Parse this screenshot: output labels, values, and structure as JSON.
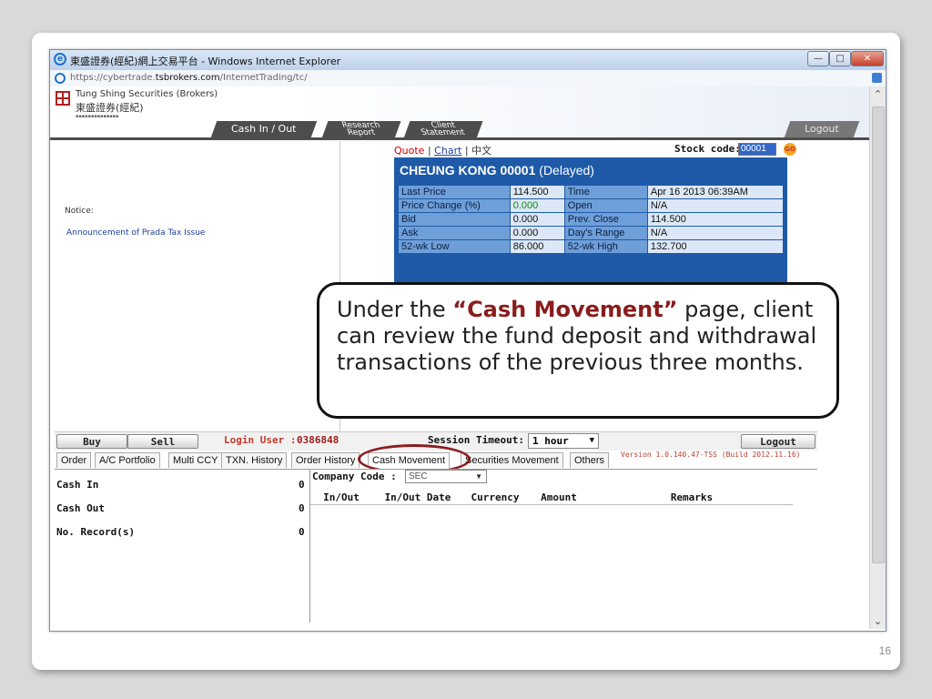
{
  "window": {
    "title": "東盛證券(經紀)網上交易平台 - Windows Internet Explorer",
    "url_prefix": "https://cybertrade.",
    "url_domain": "tsbrokers.com",
    "url_path": "/InternetTrading/tc/"
  },
  "banner": {
    "logo_en": "Tung Shing Securities (Brokers)",
    "logo_zh": "東盛證券(經紀)",
    "nav": {
      "cash": "Cash In / Out",
      "research_1": "Research",
      "research_2": "Report",
      "client_1": "Client",
      "client_2": "Statement",
      "logout": "Logout"
    }
  },
  "left": {
    "notice": "Notice:",
    "announcement": "Announcement of Prada Tax Issue"
  },
  "quote": {
    "link_quote": "Quote",
    "link_chart": "Chart",
    "link_zh": "中文",
    "sep": "|",
    "stock_label": "Stock code:",
    "stock_code": "00001",
    "title_name": "CHEUNG KONG 00001",
    "title_status": "(Delayed)",
    "rows": [
      {
        "l1": "Last Price",
        "v1": "114.500",
        "l2": "Time",
        "v2": "Apr 16 2013 06:39AM"
      },
      {
        "l1": "Price Change (%)",
        "v1": "0.000",
        "l2": "Open",
        "v2": "N/A"
      },
      {
        "l1": "Bid",
        "v1": "0.000",
        "l2": "Prev. Close",
        "v2": "114.500"
      },
      {
        "l1": "Ask",
        "v1": "0.000",
        "l2": "Day's Range",
        "v2": "N/A"
      },
      {
        "l1": "52-wk Low",
        "v1": "86.000",
        "l2": "52-wk High",
        "v2": "132.700"
      }
    ]
  },
  "callout": {
    "pre": "Under the ",
    "highlight": "“Cash Movement”",
    "post": " page, client can review the fund deposit and withdrawal transactions of the previous three months."
  },
  "loginbar": {
    "buy": "Buy",
    "sell": "Sell",
    "login_label": "Login User :",
    "login_user": "0386848",
    "session_label": "Session Timeout:",
    "session_value": "1 hour",
    "logout": "Logout"
  },
  "tabs": {
    "order": "Order",
    "portfolio": "A/C Portfolio",
    "multi": "Multi CCY",
    "txn": "TXN. History",
    "order_history": "Order History",
    "cash_movement": "Cash Movement",
    "securities": "Securities Movement",
    "others": "Others",
    "version": "Version 1.0.140.47-TSS (Build 2012.11.16)"
  },
  "summary": {
    "cash_in_label": "Cash In",
    "cash_in_value": "0",
    "cash_out_label": "Cash Out",
    "cash_out_value": "0",
    "records_label": "No. Record(s)",
    "records_value": "0"
  },
  "movement": {
    "company_label": "Company Code :",
    "company_value": "SEC",
    "columns": {
      "inout": "In/Out",
      "date": "In/Out Date",
      "currency": "Currency",
      "amount": "Amount",
      "remarks": "Remarks"
    }
  },
  "slide": {
    "number": "16"
  }
}
